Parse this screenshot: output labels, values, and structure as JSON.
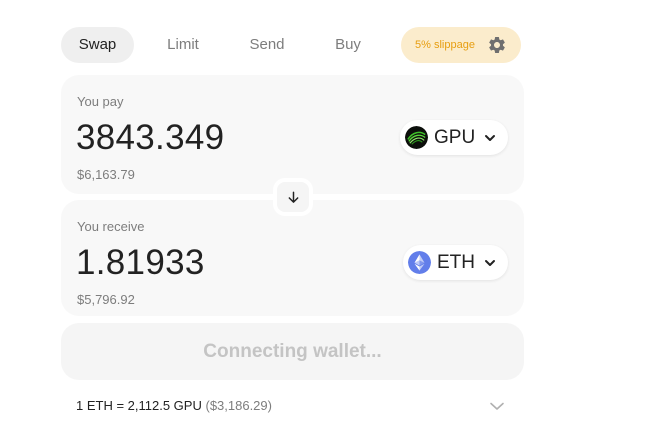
{
  "tabs": {
    "swap": "Swap",
    "limit": "Limit",
    "send": "Send",
    "buy": "Buy"
  },
  "slippage": {
    "label": "5% slippage",
    "icon": "gear-icon"
  },
  "pay": {
    "label": "You pay",
    "amount": "3843.349",
    "fiat": "$6,163.79",
    "token": {
      "symbol": "GPU",
      "icon": "gpu-token-icon",
      "color": "#0c0f0b"
    }
  },
  "receive": {
    "label": "You receive",
    "amount": "1.81933",
    "fiat": "$5,796.92",
    "token": {
      "symbol": "ETH",
      "icon": "eth-token-icon",
      "color": "#627eea"
    }
  },
  "switch": {
    "icon": "arrow-down-icon"
  },
  "connect": {
    "label": "Connecting wallet..."
  },
  "rate": {
    "text": "1 ETH = 2,112.5 GPU",
    "fiat": "($3,186.29)",
    "icon": "chevron-down-icon"
  },
  "colors": {
    "slippage_bg": "#fbeccc",
    "slippage_text": "#e79e10",
    "panel_bg": "#f8f8f8",
    "muted_text": "#7d7d7d",
    "disabled_text": "#c4c4c4"
  }
}
